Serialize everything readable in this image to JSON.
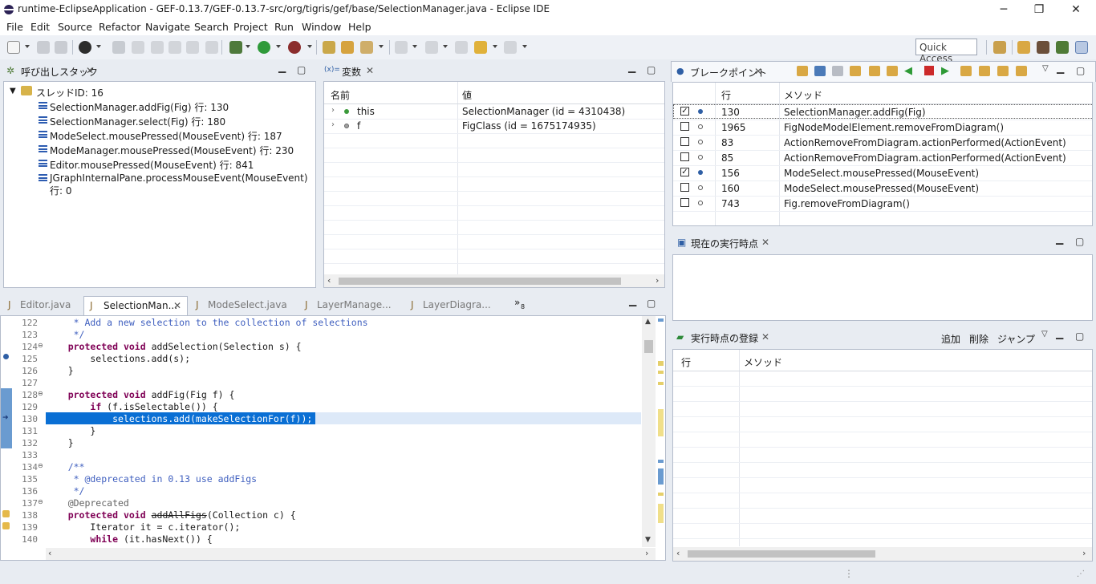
{
  "window": {
    "title": "runtime-EclipseApplication - GEF-0.13.7/GEF-0.13.7-src/org/tigris/gef/base/SelectionManager.java - Eclipse IDE",
    "minimize": "─",
    "restore": "❐",
    "close": "✕"
  },
  "menu": [
    "File",
    "Edit",
    "Source",
    "Refactor",
    "Navigate",
    "Search",
    "Project",
    "Run",
    "Window",
    "Help"
  ],
  "quick_access": "Quick Access",
  "callstack": {
    "tab": "呼び出しスタック",
    "thread": "スレッドID: 16",
    "frames": [
      "SelectionManager.addFig(Fig) 行: 130",
      "SelectionManager.select(Fig) 行: 180",
      "ModeSelect.mousePressed(MouseEvent) 行: 187",
      "ModeManager.mousePressed(MouseEvent) 行: 230",
      "Editor.mousePressed(MouseEvent) 行: 841",
      "JGraphInternalPane.processMouseEvent(MouseEvent) 行: 0"
    ]
  },
  "variables": {
    "tab": "変数",
    "tab_prefix": "(x)=",
    "col_name": "名前",
    "col_value": "値",
    "rows": [
      {
        "name": "this",
        "value": "SelectionManager (id = 4310438)"
      },
      {
        "name": "f",
        "value": "FigClass (id = 1675174935)"
      }
    ]
  },
  "breakpoints": {
    "tab": "ブレークポイント",
    "col_line": "行",
    "col_method": "メソッド",
    "rows": [
      {
        "checked": true,
        "line": "130",
        "method": "SelectionManager.addFig(Fig)"
      },
      {
        "checked": false,
        "line": "1965",
        "method": "FigNodeModelElement.removeFromDiagram()"
      },
      {
        "checked": false,
        "line": "83",
        "method": "ActionRemoveFromDiagram.actionPerformed(ActionEvent)"
      },
      {
        "checked": false,
        "line": "85",
        "method": "ActionRemoveFromDiagram.actionPerformed(ActionEvent)"
      },
      {
        "checked": true,
        "line": "156",
        "method": "ModeSelect.mousePressed(MouseEvent)"
      },
      {
        "checked": false,
        "line": "160",
        "method": "ModeSelect.mousePressed(MouseEvent)"
      },
      {
        "checked": false,
        "line": "743",
        "method": "Fig.removeFromDiagram()"
      }
    ]
  },
  "current_point": {
    "tab": "現在の実行時点"
  },
  "registered": {
    "tab": "実行時点の登録",
    "add": "追加",
    "delete": "削除",
    "jump": "ジャンプ",
    "col_line": "行",
    "col_method": "メソッド"
  },
  "editor": {
    "tabs": [
      "Editor.java",
      "SelectionMan...",
      "ModeSelect.java",
      "LayerManage...",
      "LayerDiagra..."
    ],
    "more": "»",
    "more_count": "8",
    "active_tab": 1,
    "lines": [
      {
        "n": "122",
        "t": "     * Add a new selection to the collection of selections"
      },
      {
        "n": "123",
        "t": "     */"
      },
      {
        "n": "124",
        "t": "    protected void addSelection(Selection s) {"
      },
      {
        "n": "125",
        "t": "        selections.add(s);"
      },
      {
        "n": "126",
        "t": "    }"
      },
      {
        "n": "127",
        "t": ""
      },
      {
        "n": "128",
        "t": "    protected void addFig(Fig f) {"
      },
      {
        "n": "129",
        "t": "        if (f.isSelectable()) {"
      },
      {
        "n": "130",
        "t": "            selections.add(makeSelectionFor(f));"
      },
      {
        "n": "131",
        "t": "        }"
      },
      {
        "n": "132",
        "t": "    }"
      },
      {
        "n": "133",
        "t": ""
      },
      {
        "n": "134",
        "t": "    /**"
      },
      {
        "n": "135",
        "t": "     * @deprecated in 0.13 use addFigs"
      },
      {
        "n": "136",
        "t": "     */"
      },
      {
        "n": "137",
        "t": "    @Deprecated"
      },
      {
        "n": "138",
        "t": "    protected void addAllFigs(Collection c) {"
      },
      {
        "n": "139",
        "t": "        Iterator it = c.iterator();"
      },
      {
        "n": "140",
        "t": "        while (it.hasNext()) {"
      }
    ]
  },
  "colors": {
    "accent": "#2f6db5",
    "highlight": "#0a6fd4",
    "keyword": "#7f0055",
    "comment": "#3f5fbf"
  }
}
